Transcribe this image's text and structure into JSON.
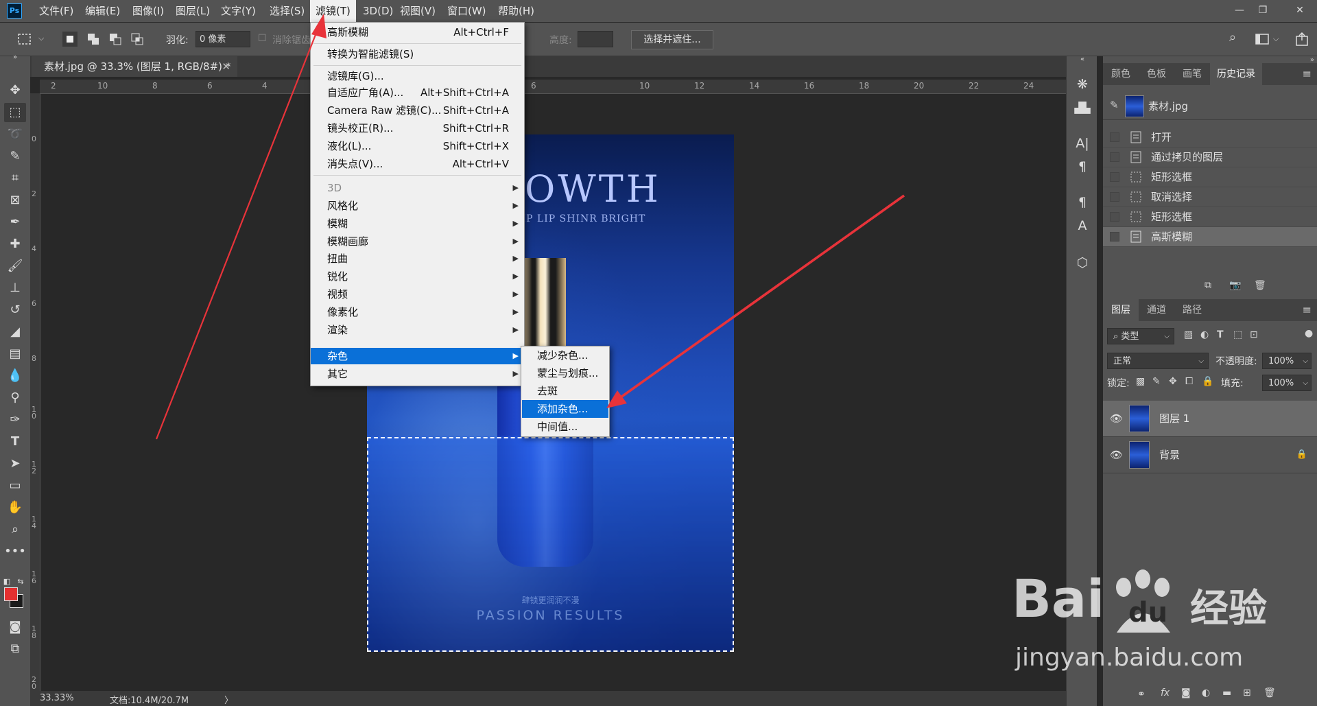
{
  "menubar": {
    "app_icon": "Ps",
    "items": [
      "文件(F)",
      "编辑(E)",
      "图像(I)",
      "图层(L)",
      "文字(Y)",
      "选择(S)",
      "滤镜(T)",
      "3D(D)",
      "视图(V)",
      "窗口(W)",
      "帮助(H)"
    ],
    "active_index": 6
  },
  "options": {
    "feather_label": "羽化:",
    "feather_value": "0 像素",
    "antialias_label": "消除锯齿",
    "height_label": "高度:",
    "select_mask_button": "选择并遮住..."
  },
  "document": {
    "tab_title": "素材.jpg @ 33.3% (图层 1, RGB/8#) *",
    "ruler_top": [
      "2",
      "10",
      "8",
      "6",
      "4",
      "2",
      "6",
      "10",
      "12",
      "14",
      "16",
      "18",
      "20",
      "22",
      "24"
    ],
    "ruler_left": [
      "0",
      "2",
      "4",
      "6",
      "8",
      "1 0",
      "1 2",
      "1 4",
      "1 6",
      "1 8",
      "2 0"
    ],
    "artwork": {
      "title": "OWTH",
      "subtitle": "RIP LIP SHINR BRIGHT",
      "caption_cn": "肆锁更润润不漫",
      "caption_en": "PASSION RESULTS"
    }
  },
  "status": {
    "zoom": "33.33%",
    "doc_info": "文档:10.4M/20.7M",
    "arrow": "〉"
  },
  "filter_menu": {
    "items": [
      {
        "label": "高斯模糊",
        "shortcut": "Alt+Ctrl+F"
      },
      {
        "label": "转换为智能滤镜(S)",
        "shortcut": ""
      },
      {
        "label": "滤镜库(G)...",
        "shortcut": ""
      },
      {
        "label": "自适应广角(A)...",
        "shortcut": "Alt+Shift+Ctrl+A"
      },
      {
        "label": "Camera Raw 滤镜(C)...",
        "shortcut": "Shift+Ctrl+A"
      },
      {
        "label": "镜头校正(R)...",
        "shortcut": "Shift+Ctrl+R"
      },
      {
        "label": "液化(L)...",
        "shortcut": "Shift+Ctrl+X"
      },
      {
        "label": "消失点(V)...",
        "shortcut": "Alt+Ctrl+V"
      },
      {
        "label": "3D",
        "shortcut": ""
      },
      {
        "label": "风格化",
        "shortcut": ""
      },
      {
        "label": "模糊",
        "shortcut": ""
      },
      {
        "label": "模糊画廊",
        "shortcut": ""
      },
      {
        "label": "扭曲",
        "shortcut": ""
      },
      {
        "label": "锐化",
        "shortcut": ""
      },
      {
        "label": "视频",
        "shortcut": ""
      },
      {
        "label": "像素化",
        "shortcut": ""
      },
      {
        "label": "渲染",
        "shortcut": ""
      },
      {
        "label": "杂色",
        "shortcut": ""
      },
      {
        "label": "其它",
        "shortcut": ""
      }
    ],
    "submenu_arrow": "▶"
  },
  "noise_submenu": {
    "items": [
      "减少杂色...",
      "蒙尘与划痕...",
      "去斑",
      "添加杂色...",
      "中间值..."
    ],
    "highlighted_index": 3
  },
  "history_panel": {
    "tabs": [
      "颜色",
      "色板",
      "画笔",
      "历史记录"
    ],
    "active_tab": "历史记录",
    "snapshot": "素材.jpg",
    "steps": [
      "打开",
      "通过拷贝的图层",
      "矩形选框",
      "取消选择",
      "矩形选框",
      "高斯模糊"
    ],
    "selected_index": 5
  },
  "layers_panel": {
    "tabs": [
      "图层",
      "通道",
      "路径"
    ],
    "active_tab": "图层",
    "filter_kind": "类型",
    "blend_mode": "正常",
    "opacity_label": "不透明度:",
    "opacity_value": "100%",
    "lock_label": "锁定:",
    "fill_label": "填充:",
    "fill_value": "100%",
    "layers": [
      {
        "name": "图层 1",
        "selected": true,
        "locked": false
      },
      {
        "name": "背景",
        "selected": false,
        "locked": true
      }
    ]
  },
  "colors": {
    "menu_highlight": "#0a70d8",
    "foreground_color": "#e42f2f",
    "background_color": "#1a1a1a",
    "annotation_arrow": "#e8333a"
  },
  "watermark": {
    "brand": "Bai",
    "brand_du": "du",
    "cn": "经验",
    "url": "jingyan.baidu.com"
  }
}
